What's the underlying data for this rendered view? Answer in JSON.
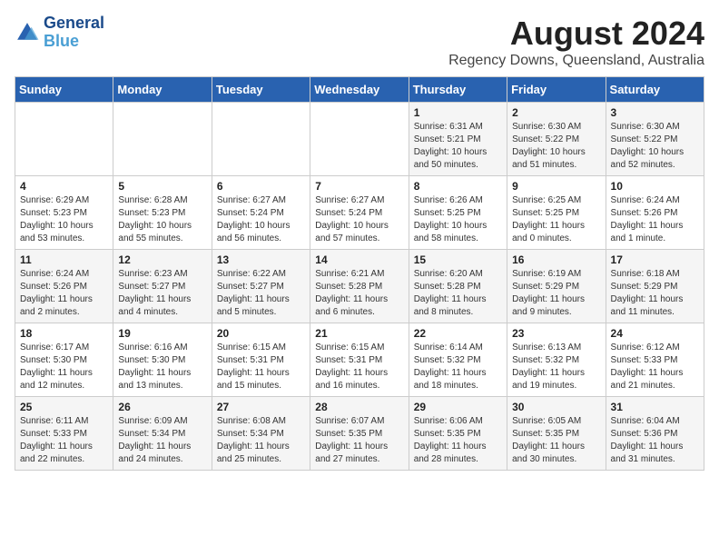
{
  "header": {
    "logo_line1": "General",
    "logo_line2": "Blue",
    "month_title": "August 2024",
    "location": "Regency Downs, Queensland, Australia"
  },
  "days_of_week": [
    "Sunday",
    "Monday",
    "Tuesday",
    "Wednesday",
    "Thursday",
    "Friday",
    "Saturday"
  ],
  "weeks": [
    [
      {
        "day": "",
        "info": ""
      },
      {
        "day": "",
        "info": ""
      },
      {
        "day": "",
        "info": ""
      },
      {
        "day": "",
        "info": ""
      },
      {
        "day": "1",
        "info": "Sunrise: 6:31 AM\nSunset: 5:21 PM\nDaylight: 10 hours\nand 50 minutes."
      },
      {
        "day": "2",
        "info": "Sunrise: 6:30 AM\nSunset: 5:22 PM\nDaylight: 10 hours\nand 51 minutes."
      },
      {
        "day": "3",
        "info": "Sunrise: 6:30 AM\nSunset: 5:22 PM\nDaylight: 10 hours\nand 52 minutes."
      }
    ],
    [
      {
        "day": "4",
        "info": "Sunrise: 6:29 AM\nSunset: 5:23 PM\nDaylight: 10 hours\nand 53 minutes."
      },
      {
        "day": "5",
        "info": "Sunrise: 6:28 AM\nSunset: 5:23 PM\nDaylight: 10 hours\nand 55 minutes."
      },
      {
        "day": "6",
        "info": "Sunrise: 6:27 AM\nSunset: 5:24 PM\nDaylight: 10 hours\nand 56 minutes."
      },
      {
        "day": "7",
        "info": "Sunrise: 6:27 AM\nSunset: 5:24 PM\nDaylight: 10 hours\nand 57 minutes."
      },
      {
        "day": "8",
        "info": "Sunrise: 6:26 AM\nSunset: 5:25 PM\nDaylight: 10 hours\nand 58 minutes."
      },
      {
        "day": "9",
        "info": "Sunrise: 6:25 AM\nSunset: 5:25 PM\nDaylight: 11 hours\nand 0 minutes."
      },
      {
        "day": "10",
        "info": "Sunrise: 6:24 AM\nSunset: 5:26 PM\nDaylight: 11 hours\nand 1 minute."
      }
    ],
    [
      {
        "day": "11",
        "info": "Sunrise: 6:24 AM\nSunset: 5:26 PM\nDaylight: 11 hours\nand 2 minutes."
      },
      {
        "day": "12",
        "info": "Sunrise: 6:23 AM\nSunset: 5:27 PM\nDaylight: 11 hours\nand 4 minutes."
      },
      {
        "day": "13",
        "info": "Sunrise: 6:22 AM\nSunset: 5:27 PM\nDaylight: 11 hours\nand 5 minutes."
      },
      {
        "day": "14",
        "info": "Sunrise: 6:21 AM\nSunset: 5:28 PM\nDaylight: 11 hours\nand 6 minutes."
      },
      {
        "day": "15",
        "info": "Sunrise: 6:20 AM\nSunset: 5:28 PM\nDaylight: 11 hours\nand 8 minutes."
      },
      {
        "day": "16",
        "info": "Sunrise: 6:19 AM\nSunset: 5:29 PM\nDaylight: 11 hours\nand 9 minutes."
      },
      {
        "day": "17",
        "info": "Sunrise: 6:18 AM\nSunset: 5:29 PM\nDaylight: 11 hours\nand 11 minutes."
      }
    ],
    [
      {
        "day": "18",
        "info": "Sunrise: 6:17 AM\nSunset: 5:30 PM\nDaylight: 11 hours\nand 12 minutes."
      },
      {
        "day": "19",
        "info": "Sunrise: 6:16 AM\nSunset: 5:30 PM\nDaylight: 11 hours\nand 13 minutes."
      },
      {
        "day": "20",
        "info": "Sunrise: 6:15 AM\nSunset: 5:31 PM\nDaylight: 11 hours\nand 15 minutes."
      },
      {
        "day": "21",
        "info": "Sunrise: 6:15 AM\nSunset: 5:31 PM\nDaylight: 11 hours\nand 16 minutes."
      },
      {
        "day": "22",
        "info": "Sunrise: 6:14 AM\nSunset: 5:32 PM\nDaylight: 11 hours\nand 18 minutes."
      },
      {
        "day": "23",
        "info": "Sunrise: 6:13 AM\nSunset: 5:32 PM\nDaylight: 11 hours\nand 19 minutes."
      },
      {
        "day": "24",
        "info": "Sunrise: 6:12 AM\nSunset: 5:33 PM\nDaylight: 11 hours\nand 21 minutes."
      }
    ],
    [
      {
        "day": "25",
        "info": "Sunrise: 6:11 AM\nSunset: 5:33 PM\nDaylight: 11 hours\nand 22 minutes."
      },
      {
        "day": "26",
        "info": "Sunrise: 6:09 AM\nSunset: 5:34 PM\nDaylight: 11 hours\nand 24 minutes."
      },
      {
        "day": "27",
        "info": "Sunrise: 6:08 AM\nSunset: 5:34 PM\nDaylight: 11 hours\nand 25 minutes."
      },
      {
        "day": "28",
        "info": "Sunrise: 6:07 AM\nSunset: 5:35 PM\nDaylight: 11 hours\nand 27 minutes."
      },
      {
        "day": "29",
        "info": "Sunrise: 6:06 AM\nSunset: 5:35 PM\nDaylight: 11 hours\nand 28 minutes."
      },
      {
        "day": "30",
        "info": "Sunrise: 6:05 AM\nSunset: 5:35 PM\nDaylight: 11 hours\nand 30 minutes."
      },
      {
        "day": "31",
        "info": "Sunrise: 6:04 AM\nSunset: 5:36 PM\nDaylight: 11 hours\nand 31 minutes."
      }
    ]
  ]
}
